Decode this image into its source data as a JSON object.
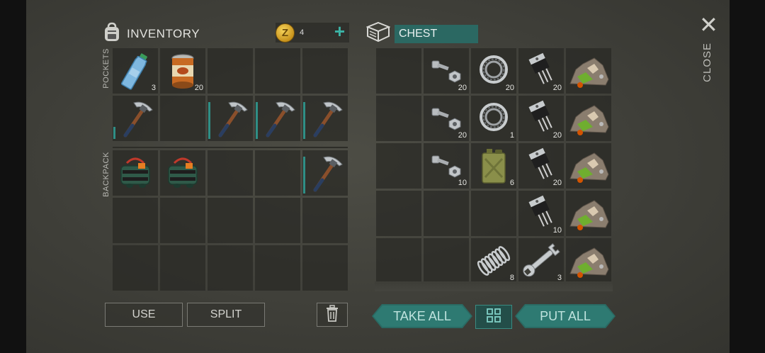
{
  "inventory": {
    "title": "INVENTORY",
    "coins": "4",
    "coin_symbol": "Z",
    "add_symbol": "+",
    "pockets_label": "POCKETS",
    "backpack_label": "BACKPACK"
  },
  "chest": {
    "title": "CHEST"
  },
  "close": {
    "icon": "✕",
    "label": "CLOSE"
  },
  "pockets_slots": [
    {
      "item": "water-bottle",
      "qty": "3"
    },
    {
      "item": "canned-food",
      "qty": "20"
    },
    {
      "item": "",
      "qty": ""
    },
    {
      "item": "",
      "qty": ""
    },
    {
      "item": "",
      "qty": ""
    },
    {
      "item": "pickaxe",
      "qty": "",
      "durability": 0.3
    },
    {
      "item": "",
      "qty": ""
    },
    {
      "item": "pickaxe",
      "qty": "",
      "durability": 0.9
    },
    {
      "item": "pickaxe",
      "qty": "",
      "durability": 0.9
    },
    {
      "item": "pickaxe",
      "qty": "",
      "durability": 0.9
    }
  ],
  "backpack_slots": [
    {
      "item": "explosive-bag",
      "qty": ""
    },
    {
      "item": "explosive-bag",
      "qty": ""
    },
    {
      "item": "",
      "qty": ""
    },
    {
      "item": "",
      "qty": ""
    },
    {
      "item": "pickaxe",
      "qty": "",
      "durability": 0.9
    },
    {
      "item": "",
      "qty": ""
    },
    {
      "item": "",
      "qty": ""
    },
    {
      "item": "",
      "qty": ""
    },
    {
      "item": "",
      "qty": ""
    },
    {
      "item": "",
      "qty": ""
    },
    {
      "item": "",
      "qty": ""
    },
    {
      "item": "",
      "qty": ""
    },
    {
      "item": "",
      "qty": ""
    },
    {
      "item": "",
      "qty": ""
    },
    {
      "item": "",
      "qty": ""
    }
  ],
  "chest_slots": [
    {
      "item": "",
      "qty": ""
    },
    {
      "item": "bolts",
      "qty": "20"
    },
    {
      "item": "bearing",
      "qty": "20"
    },
    {
      "item": "transistor",
      "qty": "20"
    },
    {
      "item": "ore-pile",
      "qty": ""
    },
    {
      "item": "",
      "qty": ""
    },
    {
      "item": "bolts",
      "qty": "20"
    },
    {
      "item": "bearing",
      "qty": "1"
    },
    {
      "item": "transistor",
      "qty": "20"
    },
    {
      "item": "ore-pile",
      "qty": ""
    },
    {
      "item": "",
      "qty": ""
    },
    {
      "item": "bolts",
      "qty": "10"
    },
    {
      "item": "jerrycan",
      "qty": "6"
    },
    {
      "item": "transistor",
      "qty": "20"
    },
    {
      "item": "ore-pile",
      "qty": ""
    },
    {
      "item": "",
      "qty": ""
    },
    {
      "item": "",
      "qty": ""
    },
    {
      "item": "",
      "qty": ""
    },
    {
      "item": "transistor",
      "qty": "10"
    },
    {
      "item": "ore-pile",
      "qty": ""
    },
    {
      "item": "",
      "qty": ""
    },
    {
      "item": "",
      "qty": ""
    },
    {
      "item": "spring",
      "qty": "8"
    },
    {
      "item": "wrench",
      "qty": "3"
    },
    {
      "item": "ore-pile",
      "qty": ""
    }
  ],
  "buttons": {
    "use": "USE",
    "split": "SPLIT",
    "take_all": "TAKE ALL",
    "put_all": "PUT ALL"
  },
  "colors": {
    "accent": "#2e7a72",
    "coin": "#e0b23a",
    "plus": "#3bb4a6"
  }
}
